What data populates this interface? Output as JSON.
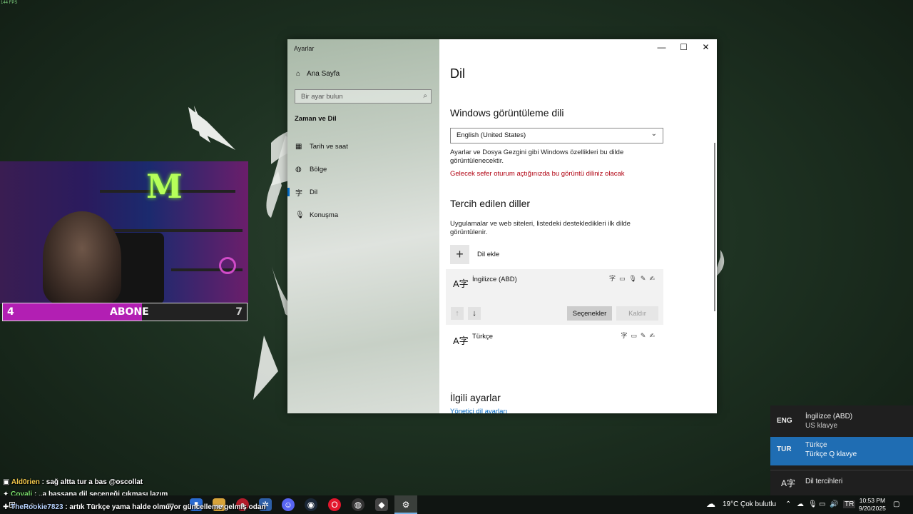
{
  "fps": "144 FPS",
  "stream": {
    "sub_goal": {
      "current": "4",
      "label": "ABONE",
      "target": "7",
      "progress": 0.57
    }
  },
  "window": {
    "app_title": "Ayarlar",
    "sidebar": {
      "home": "Ana Sayfa",
      "search_placeholder": "Bir ayar bulun",
      "section": "Zaman ve Dil",
      "items": [
        {
          "label": "Tarih ve saat",
          "icon": "calendar-clock-icon"
        },
        {
          "label": "Bölge",
          "icon": "globe-icon"
        },
        {
          "label": "Dil",
          "icon": "language-icon",
          "active": true
        },
        {
          "label": "Konuşma",
          "icon": "microphone-icon"
        }
      ]
    },
    "page_title": "Dil",
    "display_language": {
      "heading": "Windows görüntüleme dili",
      "selected": "English (United States)",
      "desc": "Ayarlar ve Dosya Gezgini gibi Windows özellikleri bu dilde görüntülenecektir.",
      "notice": "Gelecek sefer oturum açtığınızda bu görüntü diliniz olacak"
    },
    "preferred": {
      "heading": "Tercih edilen diller",
      "desc": "Uygulamalar ve web siteleri, listedeki destekledikleri ilk dilde görüntülenir.",
      "add_label": "Dil ekle",
      "languages": [
        {
          "name": "İngilizce (ABD)",
          "selected": true
        },
        {
          "name": "Türkçe",
          "selected": false
        }
      ],
      "options_button": "Seçenekler",
      "remove_button": "Kaldır"
    },
    "related": {
      "heading": "İlgili ayarlar",
      "link": "Yönetici dil ayarları"
    }
  },
  "language_flyout": {
    "items": [
      {
        "code": "ENG",
        "name": "İngilizce (ABD)",
        "keyboard": "US klavye",
        "active": false
      },
      {
        "code": "TUR",
        "name": "Türkçe",
        "keyboard": "Türkçe Q klavye",
        "active": true
      }
    ],
    "prefs": "Dil tercihleri"
  },
  "chat": [
    {
      "user": "Ald0rien",
      "message": ": sağ altta tur a bas @oscollat"
    },
    {
      "user": "Covali",
      "message": ": ..a bassana dil seçeneği çıkması lazım"
    },
    {
      "user": "TheRookie7823",
      "message": ": artık Türkçe yama halde olmuyor güncelleme gelmiş odan"
    }
  ],
  "taskbar": {
    "weather_temp": "19°C",
    "weather_desc": "Çok bulutlu",
    "input_indicator": "TR",
    "time": "10:53 PM",
    "date": "9/20/2025"
  }
}
